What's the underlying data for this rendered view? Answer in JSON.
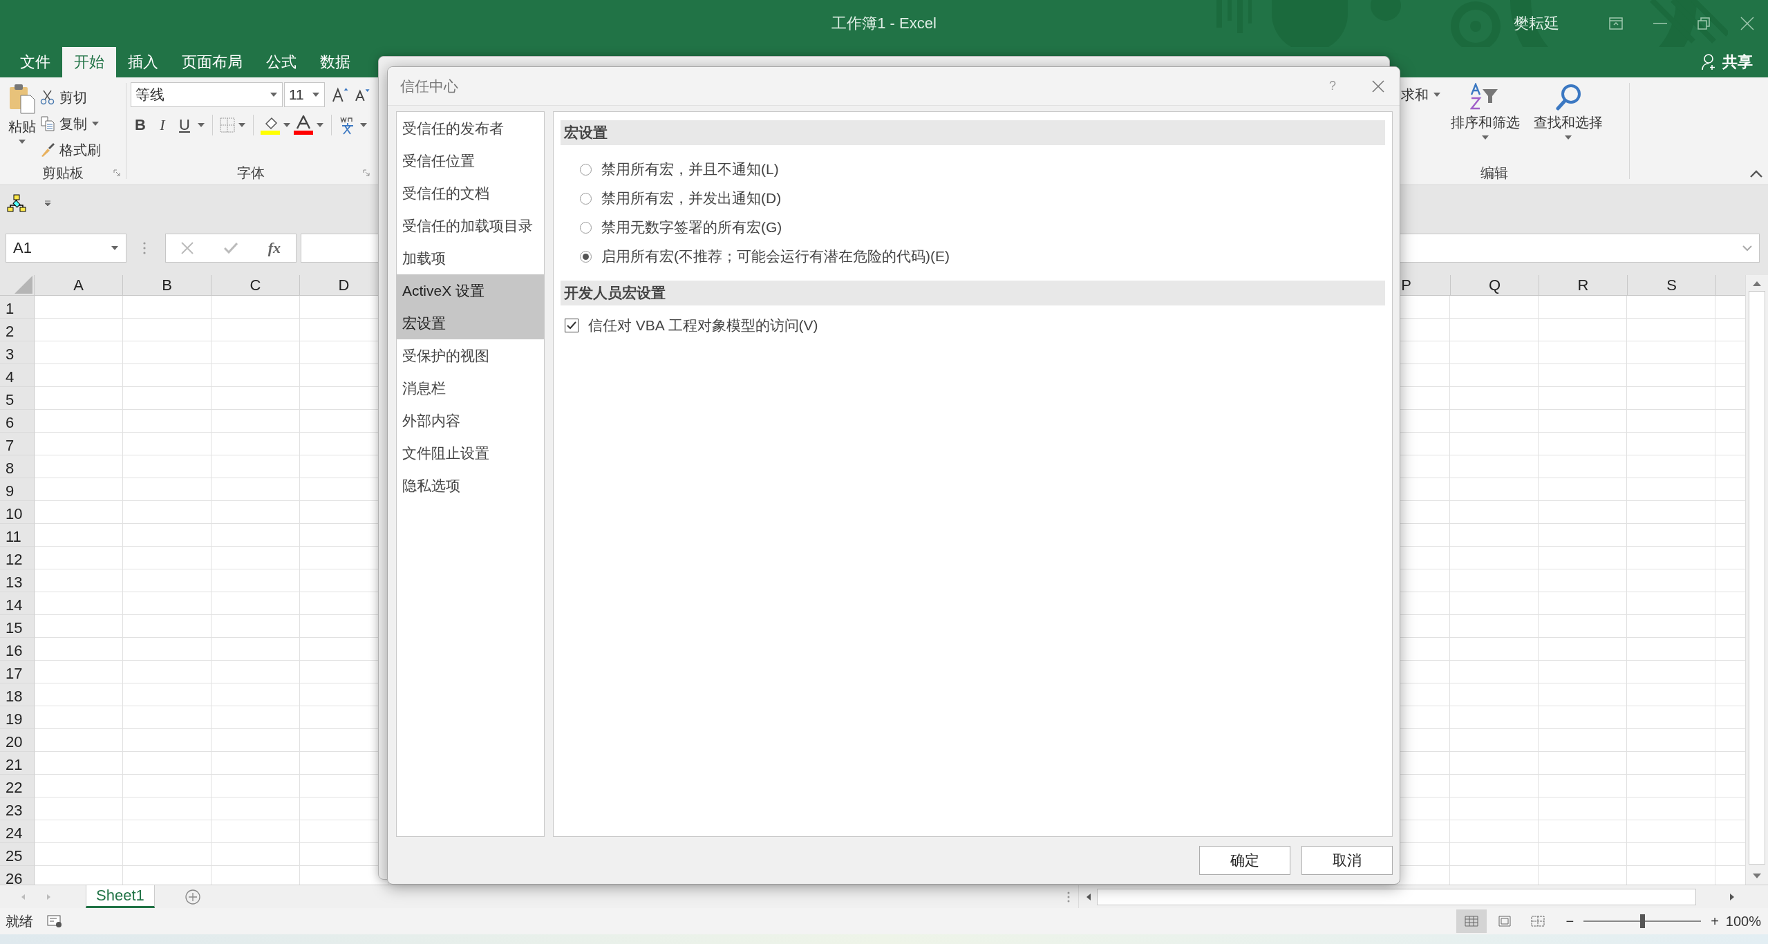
{
  "window": {
    "title": "工作簿1 - Excel",
    "user": "樊耘廷"
  },
  "ribbon_tabs": [
    {
      "label": "文件",
      "selected": false
    },
    {
      "label": "开始",
      "selected": true
    },
    {
      "label": "插入",
      "selected": false
    },
    {
      "label": "页面布局",
      "selected": false
    },
    {
      "label": "公式",
      "selected": false
    },
    {
      "label": "数据",
      "selected": false
    }
  ],
  "share": "共享",
  "clipboard": {
    "paste": "粘贴",
    "cut": "剪切",
    "copy": "复制",
    "format_painter": "格式刷",
    "group": "剪贴板"
  },
  "font": {
    "name": "等线",
    "size": "11",
    "bold": "B",
    "italic": "I",
    "underline": "U",
    "group": "字体"
  },
  "editing": {
    "autosum": "求和",
    "sort": "排序和筛选",
    "find": "查找和选择",
    "group": "编辑"
  },
  "formula_bar": {
    "name_box": "A1",
    "function_label": "fx"
  },
  "columns_left": [
    "A",
    "B",
    "C",
    "D"
  ],
  "columns_right": [
    "P",
    "Q",
    "R",
    "S"
  ],
  "rows": [
    "1",
    "2",
    "3",
    "4",
    "5",
    "6",
    "7",
    "8",
    "9",
    "10",
    "11",
    "12",
    "13",
    "14",
    "15",
    "16",
    "17",
    "18",
    "19",
    "20",
    "21",
    "22",
    "23",
    "24",
    "25",
    "26"
  ],
  "sheet_tabs": [
    {
      "label": "Sheet1",
      "selected": true
    }
  ],
  "status": "就绪",
  "view_buttons": [
    {
      "kind": "normal",
      "selected": true
    },
    {
      "kind": "page_layout",
      "selected": false
    },
    {
      "kind": "page_break",
      "selected": false
    }
  ],
  "zoom": {
    "zoom_out": "−",
    "zoom_in": "+",
    "level": 0.5,
    "reading": "100%"
  },
  "dialog": {
    "title": "信任中心",
    "help": "?",
    "nav": [
      {
        "label": "受信任的发布者",
        "selected": false
      },
      {
        "label": "受信任位置",
        "selected": false
      },
      {
        "label": "受信任的文档",
        "selected": false
      },
      {
        "label": "受信任的加载项目录",
        "selected": false
      },
      {
        "label": "加载项",
        "selected": false
      },
      {
        "label": "ActiveX 设置",
        "selected": true
      },
      {
        "label": "宏设置",
        "selected": true
      },
      {
        "label": "受保护的视图",
        "selected": false
      },
      {
        "label": "消息栏",
        "selected": false
      },
      {
        "label": "外部内容",
        "selected": false
      },
      {
        "label": "文件阻止设置",
        "selected": false
      },
      {
        "label": "隐私选项",
        "selected": false
      }
    ],
    "sections": [
      {
        "title": "宏设置",
        "options": [
          {
            "kind": "radio",
            "label": "禁用所有宏，并且不通知(L)",
            "selected": false
          },
          {
            "kind": "radio",
            "label": "禁用所有宏，并发出通知(D)",
            "selected": false
          },
          {
            "kind": "radio",
            "label": "禁用无数字签署的所有宏(G)",
            "selected": false
          },
          {
            "kind": "radio",
            "label": "启用所有宏(不推荐；可能会运行有潜在危险的代码)(E)",
            "selected": true
          }
        ]
      },
      {
        "title": "开发人员宏设置",
        "options": [
          {
            "kind": "checkbox",
            "label": "信任对 VBA 工程对象模型的访问(V)",
            "checked": true
          }
        ]
      }
    ],
    "buttons": [
      "确定",
      "取消"
    ]
  }
}
